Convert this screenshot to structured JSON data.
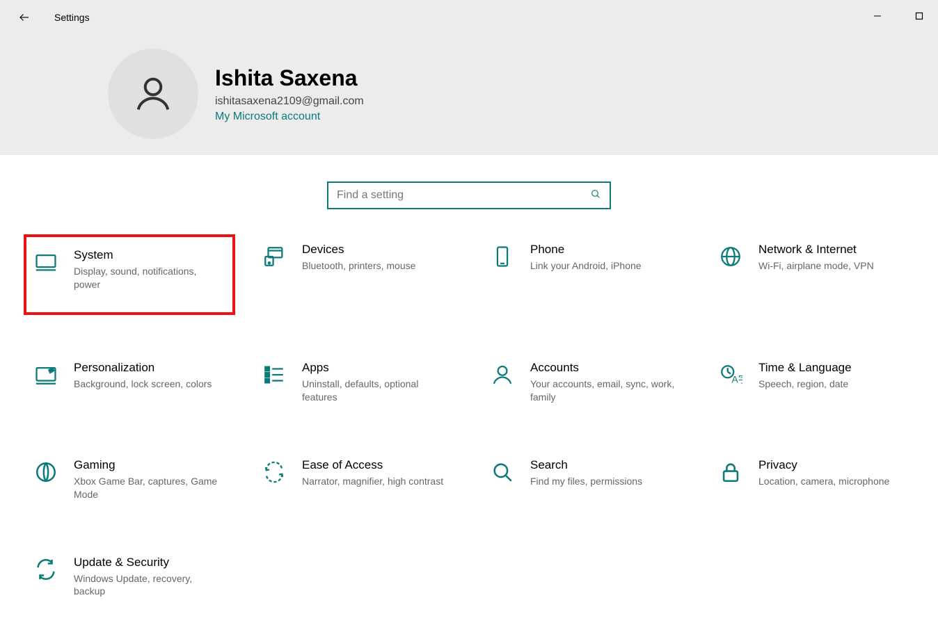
{
  "window": {
    "title": "Settings"
  },
  "profile": {
    "name": "Ishita Saxena",
    "email": "ishitasaxena2109@gmail.com",
    "link": "My Microsoft account"
  },
  "search": {
    "placeholder": "Find a setting"
  },
  "accent": "#0b7a78",
  "highlight": "#e11",
  "cards": [
    {
      "id": "system",
      "title": "System",
      "desc": "Display, sound, notifications, power",
      "highlighted": true
    },
    {
      "id": "devices",
      "title": "Devices",
      "desc": "Bluetooth, printers, mouse"
    },
    {
      "id": "phone",
      "title": "Phone",
      "desc": "Link your Android, iPhone"
    },
    {
      "id": "network",
      "title": "Network & Internet",
      "desc": "Wi-Fi, airplane mode, VPN"
    },
    {
      "id": "personalization",
      "title": "Personalization",
      "desc": "Background, lock screen, colors"
    },
    {
      "id": "apps",
      "title": "Apps",
      "desc": "Uninstall, defaults, optional features"
    },
    {
      "id": "accounts",
      "title": "Accounts",
      "desc": "Your accounts, email, sync, work, family"
    },
    {
      "id": "time_language",
      "title": "Time & Language",
      "desc": "Speech, region, date"
    },
    {
      "id": "gaming",
      "title": "Gaming",
      "desc": "Xbox Game Bar, captures, Game Mode"
    },
    {
      "id": "ease_of_access",
      "title": "Ease of Access",
      "desc": "Narrator, magnifier, high contrast"
    },
    {
      "id": "search",
      "title": "Search",
      "desc": "Find my files, permissions"
    },
    {
      "id": "privacy",
      "title": "Privacy",
      "desc": "Location, camera, microphone"
    },
    {
      "id": "update_security",
      "title": "Update & Security",
      "desc": "Windows Update, recovery, backup"
    }
  ]
}
